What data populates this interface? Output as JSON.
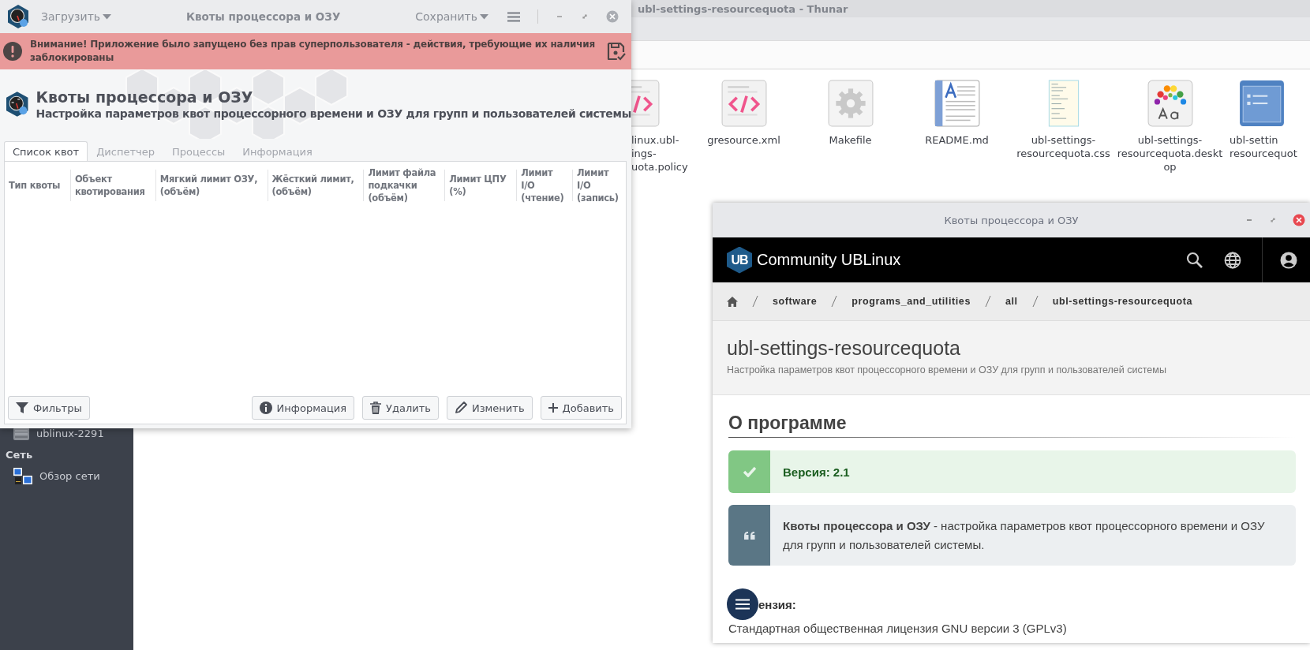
{
  "file_manager": {
    "title": "ubl-settings-resourcequota - Thunar",
    "sidebar": [
      {
        "kind": "device",
        "label": "ublinux-2291"
      },
      {
        "kind": "heading",
        "label": "Сеть"
      },
      {
        "kind": "network",
        "label": "Обзор сети"
      }
    ],
    "files": [
      {
        "kind": "code",
        "lines": [
          "linux.ubl-",
          "ings-",
          "uota.policy"
        ]
      },
      {
        "kind": "code",
        "lines": [
          "gresource.xml"
        ]
      },
      {
        "kind": "gear",
        "lines": [
          "Makefile"
        ]
      },
      {
        "kind": "document",
        "lines": [
          "README.md"
        ]
      },
      {
        "kind": "stylesheet",
        "lines": [
          "ubl-settings-",
          "resourcequota.css"
        ]
      },
      {
        "kind": "desktop",
        "lines": [
          "ubl-settings-",
          "resourcequota.deskt",
          "op"
        ]
      },
      {
        "kind": "layout",
        "lines": [
          "ubl-settin",
          "resourcequot"
        ]
      }
    ]
  },
  "app_window": {
    "title": "Квоты процессора и ОЗУ",
    "load_menu": "Загрузить",
    "save_menu": "Сохранить",
    "warning": "Внимание! Приложение было запущено без прав суперпользователя - действия, требующие их наличия заблокированы",
    "header": {
      "title": "Квоты процессора и ОЗУ",
      "subtitle": "Настройка параметров квот процессорного времени и ОЗУ для групп и пользователей системы"
    },
    "tabs": [
      {
        "label": "Список квот",
        "selected": true
      },
      {
        "label": "Диспетчер",
        "selected": false
      },
      {
        "label": "Процессы",
        "selected": false
      },
      {
        "label": "Информация",
        "selected": false
      }
    ],
    "columns": [
      "Тип квоты",
      "Объект квотирования",
      "Мягкий лимит ОЗУ, (объём)",
      "Жёсткий лимит, (объём)",
      "Лимит файла подкачки (объём)",
      "Лимит ЦПУ (%)",
      "Лимит I/O (чтение)",
      "Лимит I/O (запись)"
    ],
    "buttons": [
      {
        "kind": "filter",
        "label": "Фильтры"
      },
      {
        "kind": "info",
        "label": "Информация"
      },
      {
        "kind": "trash",
        "label": "Удалить"
      },
      {
        "kind": "pencil",
        "label": "Изменить"
      },
      {
        "kind": "plus",
        "label": "Добавить"
      }
    ]
  },
  "browser_window": {
    "title": "Квоты процессора и ОЗУ",
    "logo_text": "UB",
    "site_name": "Community UBLinux",
    "breadcrumbs": [
      "software",
      "programs_and_utilities",
      "all",
      "ubl-settings-resourcequota"
    ],
    "page_title": "ubl-settings-resourcequota",
    "page_subtitle": "Настройка параметров квот процессорного времени и ОЗУ для групп и пользователей системы",
    "section_title": "О программе",
    "version_note": "Версия: 2.1",
    "description": "**Квоты процессора и ОЗУ** - настройка параметров квот процессорного времени и ОЗУ для групп и пользователей системы.",
    "license_label": "ензия:",
    "license_text": "Стандартная общественная лицензия GNU версии 3 (GPLv3)"
  }
}
